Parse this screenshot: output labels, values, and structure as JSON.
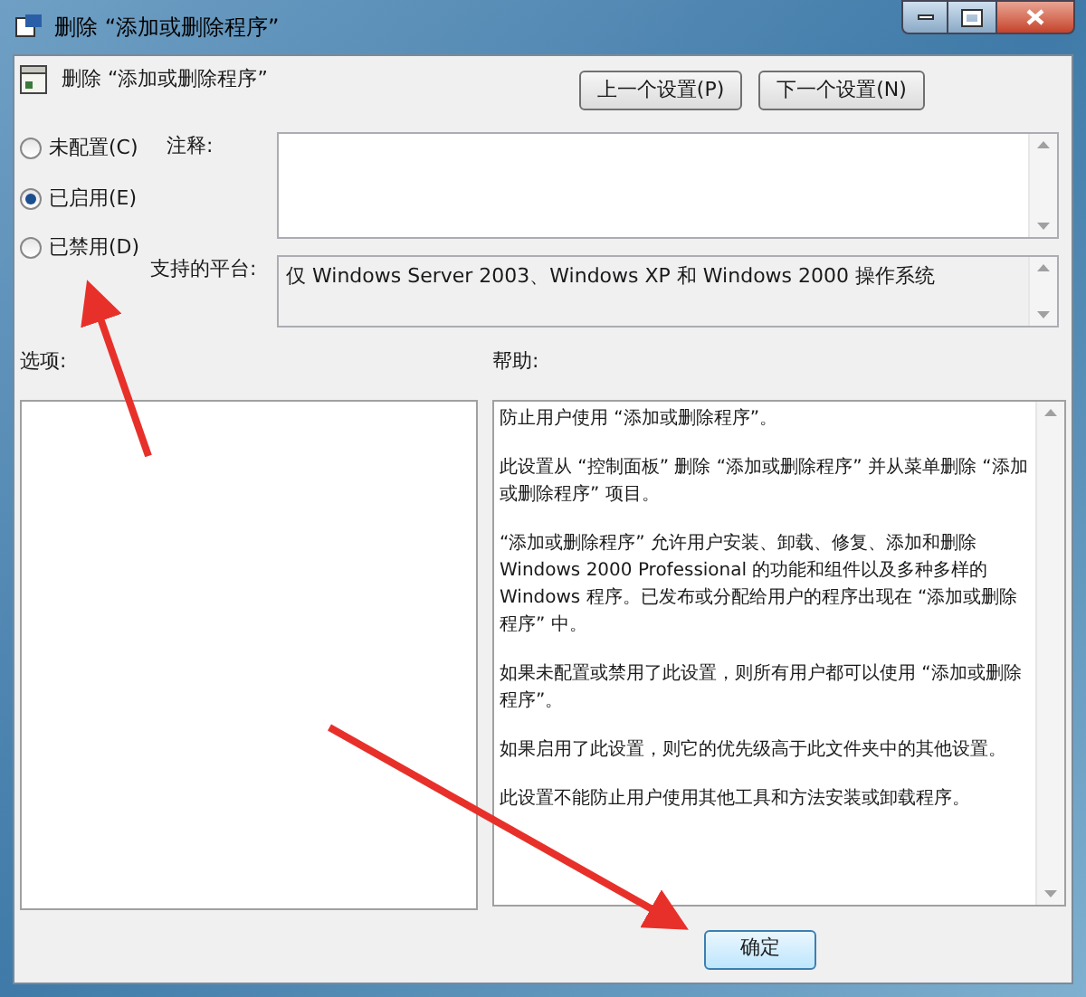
{
  "window": {
    "title": "删除 “添加或删除程序”"
  },
  "header": {
    "title": "删除 “添加或删除程序”",
    "buttons": [
      "上一个设置(P)",
      "下一个设置(N)"
    ]
  },
  "options": [
    {
      "label": "未配置(C)",
      "selected": false
    },
    {
      "label": "已启用(E)",
      "selected": true
    },
    {
      "label": "已禁用(D)",
      "selected": false
    }
  ],
  "comment": {
    "label": "注释:"
  },
  "platform": {
    "label": "支持的平台:",
    "value": "仅 Windows Server 2003、Windows XP 和 Windows 2000 操作系统"
  },
  "options_label": "选项:",
  "help": {
    "label": "帮助:",
    "paragraphs": [
      "防止用户使用 “添加或删除程序”。",
      "此设置从 “控制面板” 删除 “添加或删除程序” 并从菜单删除 “添加或删除程序” 项目。",
      "“添加或删除程序” 允许用户安装、卸载、修复、添加和删除 Windows 2000 Professional 的功能和组件以及多种多样的 Windows 程序。已发布或分配给用户的程序出现在 “添加或删除程序” 中。",
      "如果未配置或禁用了此设置，则所有用户都可以使用 “添加或删除程序”。",
      "如果启用了此设置，则它的优先级高于此文件夹中的其他设置。",
      "此设置不能防止用户使用其他工具和方法安装或卸载程序。"
    ]
  },
  "footer_buttons": [
    "确定"
  ]
}
